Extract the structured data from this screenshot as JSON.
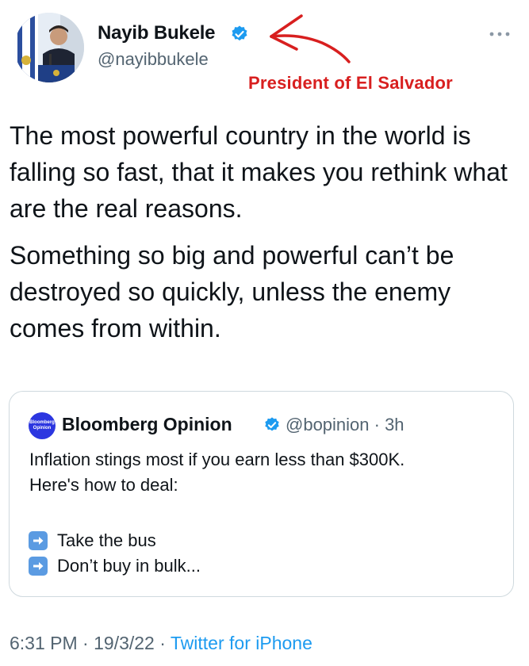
{
  "author": {
    "name": "Nayib Bukele",
    "handle": "@nayibbukele"
  },
  "annotation": {
    "text": "President of El Salvador",
    "color": "#d81f1f"
  },
  "tweet": {
    "paragraphs": [
      "The most powerful country in the world is falling so fast, that it makes you rethink what are the real reasons.",
      "Something so big and powerful can’t be destroyed so quickly, unless the enemy comes from within."
    ]
  },
  "quote": {
    "avatar_text_line1": "Bloomberg",
    "avatar_text_line2": "Opinion",
    "name": "Bloomberg Opinion",
    "handle_time": "@bopinion · 3h",
    "body_lines": [
      "Inflation stings most if you earn less than $300K.",
      "Here's how to deal:"
    ],
    "bullets": [
      "Take the bus",
      "Don’t buy in bulk..."
    ],
    "bullet_icon": "right-arrow-emoji-icon"
  },
  "footer": {
    "time": "6:31 PM",
    "separator": " · ",
    "date": "19/3/22",
    "source": "Twitter for iPhone"
  },
  "colors": {
    "verified_blue": "#1d9bf0",
    "link_blue": "#1d9bf0",
    "secondary_text": "#536471",
    "bloomberg_purple": "#2c36e0"
  }
}
